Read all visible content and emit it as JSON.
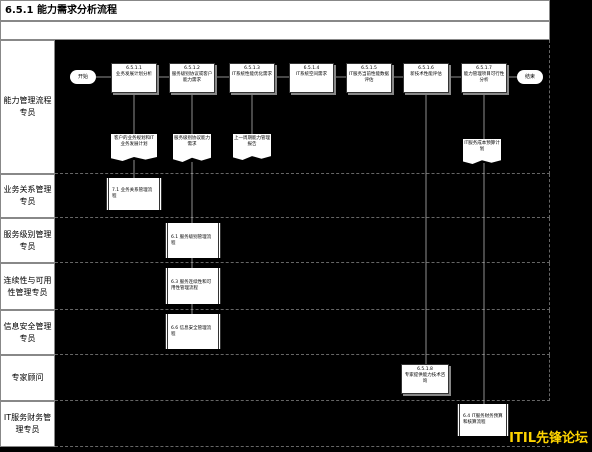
{
  "title": "6.5.1 能力需求分析流程",
  "lanes": [
    {
      "label": "能力管理流程专员"
    },
    {
      "label": "业务关系管理专员"
    },
    {
      "label": "服务级别管理专员"
    },
    {
      "label": "连续性与可用性管理专员"
    },
    {
      "label": "信息安全管理专员"
    },
    {
      "label": "专家顾问"
    },
    {
      "label": "IT服务财务管理专员"
    }
  ],
  "start": "开始",
  "end": "结束",
  "steps": [
    {
      "code": "6.5.1.1",
      "label": "业务发展计划分析"
    },
    {
      "code": "6.5.1.2",
      "label": "服务级别协议或客户能力需求"
    },
    {
      "code": "6.5.1.3",
      "label": "IT系统性能优化需求"
    },
    {
      "code": "6.5.1.4",
      "label": "IT系统空间需求"
    },
    {
      "code": "6.5.1.5",
      "label": "IT服务当前性能数据评估"
    },
    {
      "code": "6.5.1.6",
      "label": "新技术性能评估"
    },
    {
      "code": "6.5.1.7",
      "label": "能力管理项目可行性分析"
    },
    {
      "code": "6.5.1.8",
      "label": "专家提供能力技术咨询"
    }
  ],
  "documents": [
    {
      "label": "客户的业务规划和IT业务发展计划"
    },
    {
      "label": "服务级别协议能力需求"
    },
    {
      "label": "上一周期能力管理报告"
    },
    {
      "label": "IT服务成本预算计划"
    }
  ],
  "subprocesses": [
    {
      "label": "7.1 业务关系管理流程"
    },
    {
      "label": "6.1 服务级别管理流程"
    },
    {
      "label": "6.3 服务连续性和可用性管理流程"
    },
    {
      "label": "6.6 信息安全管理流程"
    },
    {
      "label": "6.4 IT服务财务预算和核算流程"
    }
  ],
  "watermark": "ITIL先锋论坛"
}
